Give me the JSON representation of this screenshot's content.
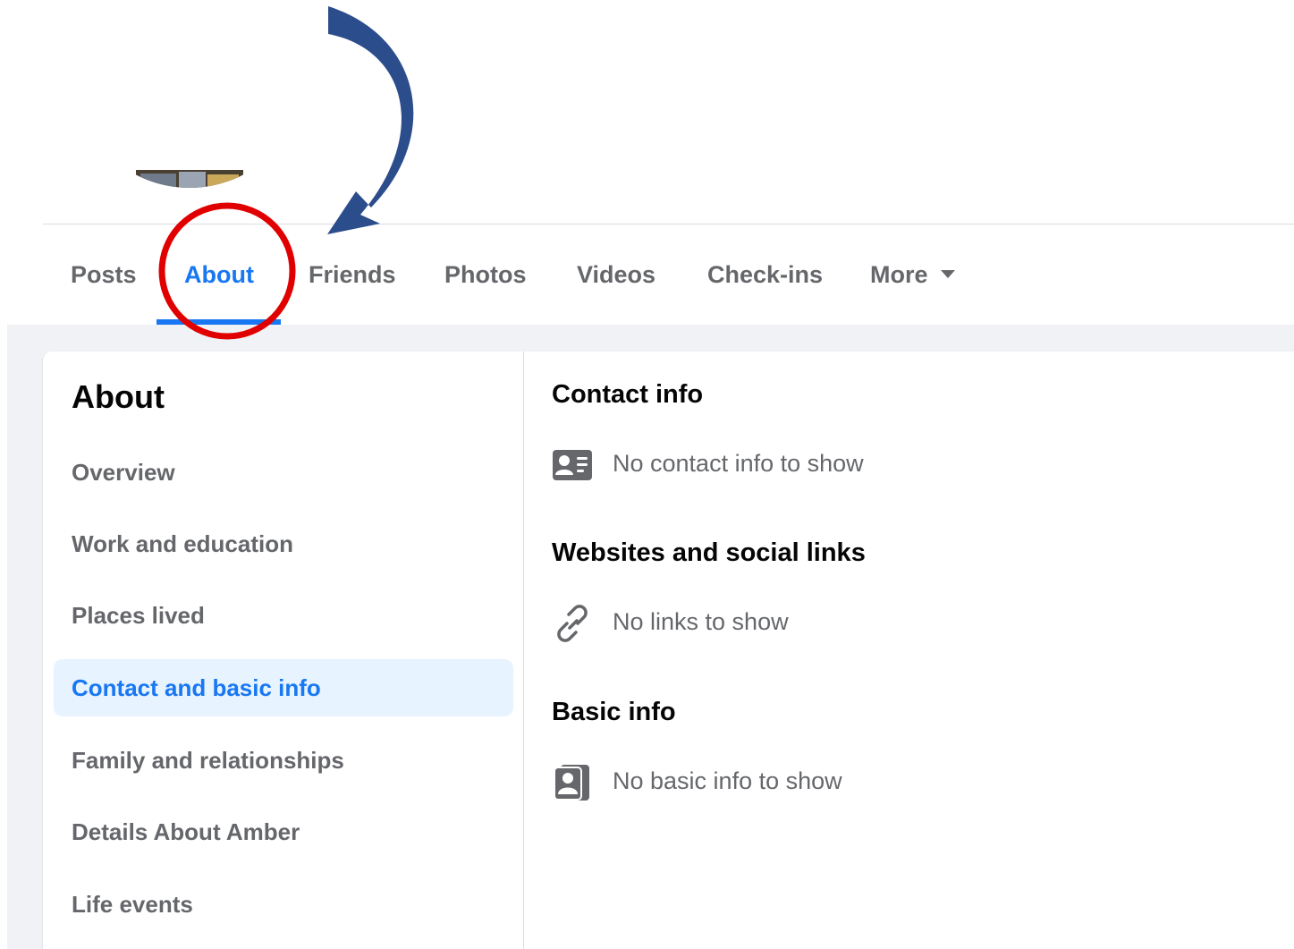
{
  "tabs": {
    "items": [
      {
        "label": "Posts"
      },
      {
        "label": "About"
      },
      {
        "label": "Friends"
      },
      {
        "label": "Photos"
      },
      {
        "label": "Videos"
      },
      {
        "label": "Check-ins"
      },
      {
        "label": "More"
      }
    ],
    "active_index": 1
  },
  "sidebar": {
    "title": "About",
    "items": [
      {
        "label": "Overview"
      },
      {
        "label": "Work and education"
      },
      {
        "label": "Places lived"
      },
      {
        "label": "Contact and basic info"
      },
      {
        "label": "Family and relationships"
      },
      {
        "label": "Details About Amber"
      },
      {
        "label": "Life events"
      }
    ],
    "selected_index": 3
  },
  "main": {
    "contact": {
      "title": "Contact info",
      "empty_text": "No contact info to show",
      "icon": "contact-card-icon"
    },
    "websites": {
      "title": "Websites and social links",
      "empty_text": "No links to show",
      "icon": "link-icon"
    },
    "basic": {
      "title": "Basic info",
      "empty_text": "No basic info to show",
      "icon": "profile-photo-icon"
    }
  },
  "colors": {
    "accent": "#1877f2",
    "selected_bg": "#e7f3ff",
    "muted_text": "#65676b",
    "page_bg": "#f0f2f5",
    "annotation_circle": "#e10000",
    "annotation_arrow": "#2b4d8c"
  }
}
